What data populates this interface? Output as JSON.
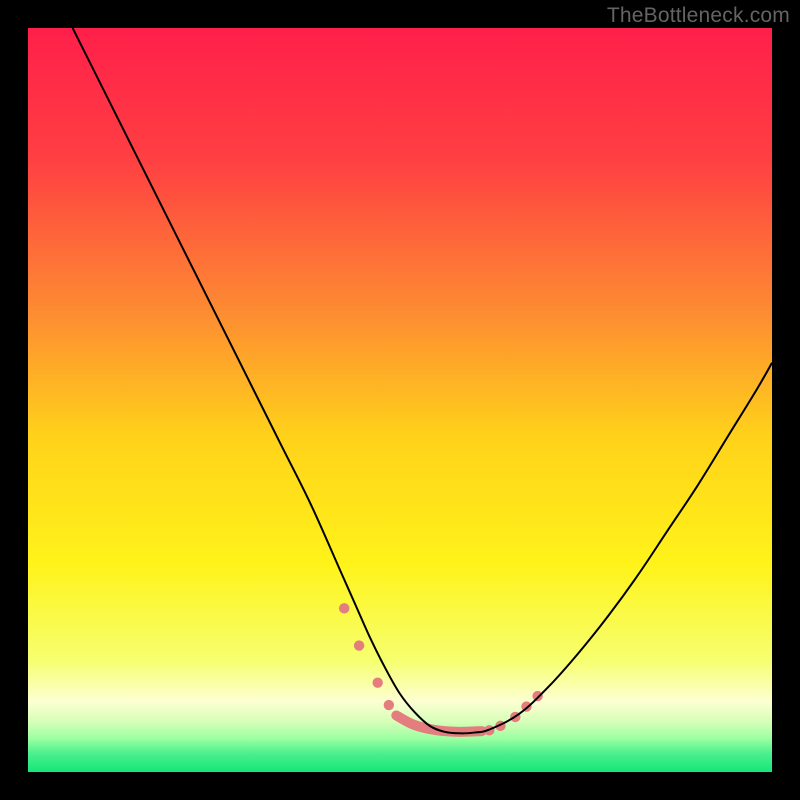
{
  "watermark": "TheBottleneck.com",
  "chart_data": {
    "type": "line",
    "title": "",
    "xlabel": "",
    "ylabel": "",
    "xlim": [
      0,
      100
    ],
    "ylim": [
      0,
      100
    ],
    "background_gradient": {
      "stops": [
        {
          "offset": 0.0,
          "color": "#ff1f4a"
        },
        {
          "offset": 0.18,
          "color": "#ff4042"
        },
        {
          "offset": 0.38,
          "color": "#fd8b32"
        },
        {
          "offset": 0.55,
          "color": "#ffd21a"
        },
        {
          "offset": 0.72,
          "color": "#fff31a"
        },
        {
          "offset": 0.85,
          "color": "#f6ff6f"
        },
        {
          "offset": 0.905,
          "color": "#fdffd2"
        },
        {
          "offset": 0.932,
          "color": "#d7ffb9"
        },
        {
          "offset": 0.955,
          "color": "#9cffa2"
        },
        {
          "offset": 0.975,
          "color": "#4cf08e"
        },
        {
          "offset": 1.0,
          "color": "#14e777"
        }
      ]
    },
    "series": [
      {
        "name": "bottleneck-curve",
        "color": "#000000",
        "x": [
          6,
          10,
          14,
          18,
          22,
          26,
          30,
          34,
          38,
          42,
          44,
          46,
          48,
          50,
          52,
          54,
          56,
          58,
          60,
          62,
          66,
          70,
          74,
          78,
          82,
          86,
          90,
          94,
          98,
          100
        ],
        "y": [
          100,
          92,
          84,
          76,
          68,
          60,
          52,
          44,
          36,
          27,
          22.5,
          18,
          14,
          10.5,
          8,
          6.2,
          5.4,
          5.2,
          5.3,
          5.7,
          7.8,
          11.5,
          16,
          21,
          26.5,
          32.5,
          38.5,
          45,
          51.5,
          55
        ]
      }
    ],
    "guide_dots": {
      "color": "#e47d7d",
      "radius": 5.2,
      "points": [
        {
          "x": 42.5,
          "y": 22.0
        },
        {
          "x": 44.5,
          "y": 17.0
        },
        {
          "x": 47.0,
          "y": 12.0
        },
        {
          "x": 48.5,
          "y": 9.0
        },
        {
          "x": 62.0,
          "y": 5.6
        },
        {
          "x": 63.5,
          "y": 6.2
        },
        {
          "x": 65.5,
          "y": 7.4
        },
        {
          "x": 67.0,
          "y": 8.8
        },
        {
          "x": 68.5,
          "y": 10.2
        }
      ]
    },
    "guide_band": {
      "color": "#e47d7d",
      "thickness": 10,
      "x": [
        49.5,
        52,
        55,
        58,
        61
      ],
      "y": [
        7.6,
        6.3,
        5.6,
        5.4,
        5.5
      ]
    }
  }
}
